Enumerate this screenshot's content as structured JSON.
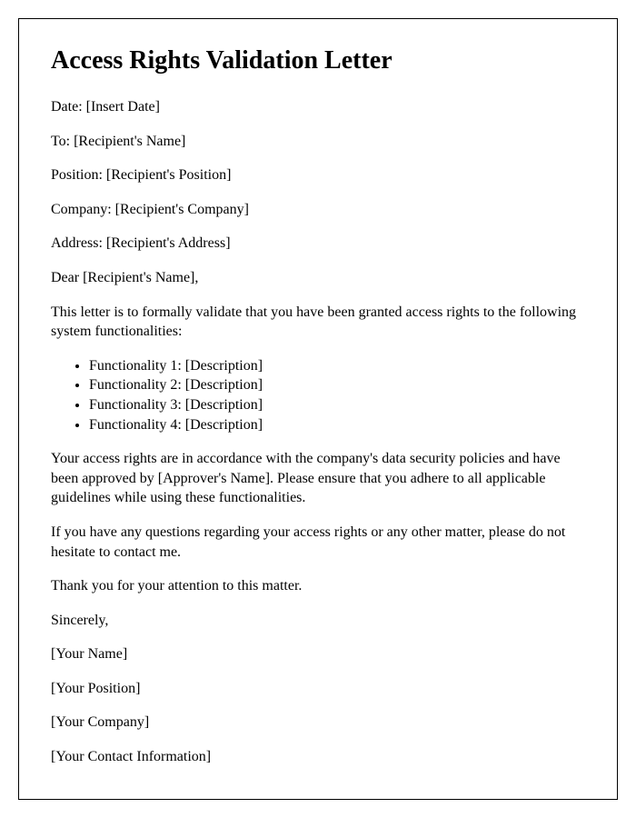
{
  "title": "Access Rights Validation Letter",
  "date": "Date: [Insert Date]",
  "to": "To: [Recipient's Name]",
  "position": "Position: [Recipient's Position]",
  "company": "Company: [Recipient's Company]",
  "address": "Address: [Recipient's Address]",
  "salutation": "Dear [Recipient's Name],",
  "intro": "This letter is to formally validate that you have been granted access rights to the following system functionalities:",
  "functionalities": [
    "Functionality 1: [Description]",
    "Functionality 2: [Description]",
    "Functionality 3: [Description]",
    "Functionality 4: [Description]"
  ],
  "policy_para": "Your access rights are in accordance with the company's data security policies and have been approved by [Approver's Name]. Please ensure that you adhere to all applicable guidelines while using these functionalities.",
  "questions_para": "If you have any questions regarding your access rights or any other matter, please do not hesitate to contact me.",
  "thanks": "Thank you for your attention to this matter.",
  "closing": "Sincerely,",
  "sender_name": "[Your Name]",
  "sender_position": "[Your Position]",
  "sender_company": "[Your Company]",
  "sender_contact": "[Your Contact Information]"
}
